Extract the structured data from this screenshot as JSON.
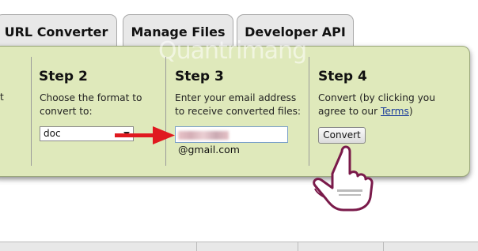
{
  "tabs": {
    "url_converter": "URL Converter",
    "manage_files": "Manage Files",
    "developer_api": "Developer API"
  },
  "steps": {
    "step1_partial_text": "t",
    "step2": {
      "title": "Step 2",
      "desc": "Choose the format to convert to:",
      "selected_format": "doc"
    },
    "step3": {
      "title": "Step 3",
      "desc": "Enter your email address to receive converted files:",
      "email_value": "@gmail.com"
    },
    "step4": {
      "title": "Step 4",
      "desc_before": "Convert (by clicking you agree to our ",
      "terms_link": "Terms",
      "desc_after": ")",
      "convert_button": "Convert"
    }
  },
  "watermark": "Quantrimang",
  "colors": {
    "panel_bg": "#dfe9bb",
    "arrow": "#e0191f",
    "hand_outline": "#7a1a4a"
  }
}
